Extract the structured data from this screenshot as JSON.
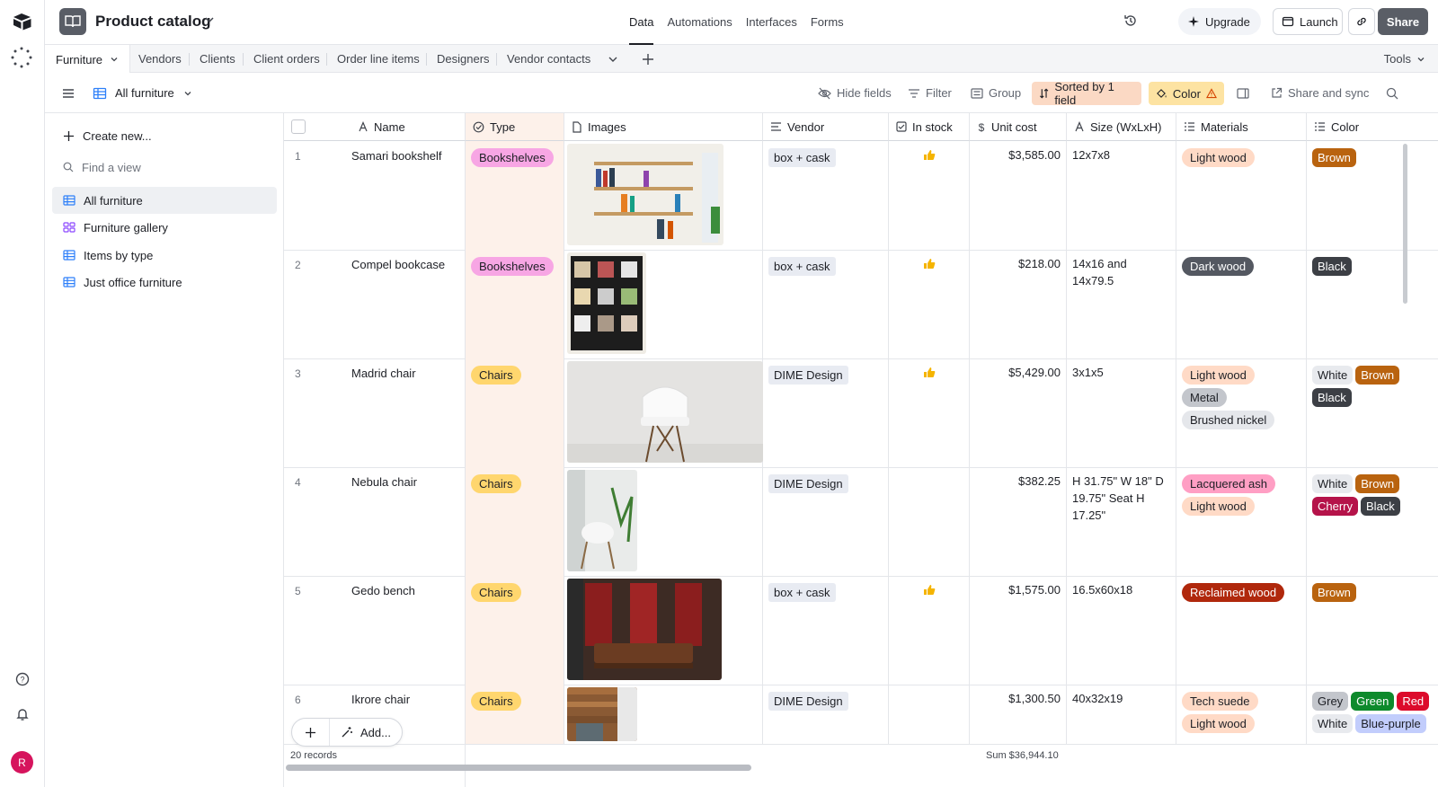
{
  "header": {
    "base_title": "Product catalog",
    "nav": [
      "Data",
      "Automations",
      "Interfaces",
      "Forms"
    ],
    "upgrade": "Upgrade",
    "launch": "Launch",
    "share": "Share"
  },
  "tabs": {
    "active": "Furniture",
    "items": [
      "Vendors",
      "Clients",
      "Client orders",
      "Order line items",
      "Designers",
      "Vendor contacts"
    ],
    "tools": "Tools"
  },
  "viewbar": {
    "view_name": "All furniture",
    "hide_fields": "Hide fields",
    "filter": "Filter",
    "group": "Group",
    "sorted": "Sorted by 1 field",
    "color": "Color",
    "share_sync": "Share and sync"
  },
  "sidebar": {
    "create_new": "Create new...",
    "find_view": "Find a view",
    "views": [
      "All furniture",
      "Furniture gallery",
      "Items by type",
      "Just office furniture"
    ]
  },
  "columns": [
    "Name",
    "Type",
    "Images",
    "Vendor",
    "In stock",
    "Unit cost",
    "Size (WxLxH)",
    "Materials",
    "Color"
  ],
  "rows": [
    {
      "num": "1",
      "name": "Samari bookshelf",
      "type": "Bookshelves",
      "vendor": "box + cask",
      "in_stock": true,
      "cost": "$3,585.00",
      "size": "12x7x8",
      "materials": [
        "Light wood"
      ],
      "colors": [
        "Brown"
      ]
    },
    {
      "num": "2",
      "name": "Compel bookcase",
      "type": "Bookshelves",
      "vendor": "box + cask",
      "in_stock": true,
      "cost": "$218.00",
      "size": "14x16 and 14x79.5",
      "materials": [
        "Dark wood"
      ],
      "colors": [
        "Black"
      ]
    },
    {
      "num": "3",
      "name": "Madrid chair",
      "type": "Chairs",
      "vendor": "DIME Design",
      "in_stock": true,
      "cost": "$5,429.00",
      "size": "3x1x5",
      "materials": [
        "Light wood",
        "Metal",
        "Brushed nickel"
      ],
      "colors": [
        "White",
        "Brown",
        "Black"
      ]
    },
    {
      "num": "4",
      "name": "Nebula chair",
      "type": "Chairs",
      "vendor": "DIME Design",
      "in_stock": false,
      "cost": "$382.25",
      "size": "H 31.75\" W 18\" D 19.75\" Seat H 17.25\"",
      "materials": [
        "Lacquered ash",
        "Light wood"
      ],
      "colors": [
        "White",
        "Brown",
        "Cherry",
        "Black"
      ]
    },
    {
      "num": "5",
      "name": "Gedo bench",
      "type": "Chairs",
      "vendor": "box + cask",
      "in_stock": true,
      "cost": "$1,575.00",
      "size": "16.5x60x18",
      "materials": [
        "Reclaimed wood"
      ],
      "colors": [
        "Brown"
      ]
    },
    {
      "num": "6",
      "name": "Ikrore chair",
      "type": "Chairs",
      "vendor": "DIME Design",
      "in_stock": false,
      "cost": "$1,300.50",
      "size": "40x32x19",
      "materials": [
        "Tech suede",
        "Light wood"
      ],
      "colors": [
        "Grey",
        "Green",
        "Red",
        "White",
        "Blue-purple"
      ]
    }
  ],
  "footer": {
    "records": "20 records",
    "sum": "Sum $36,944.10",
    "add": "Add..."
  },
  "pill_colors": {
    "Bookshelves": {
      "bg": "#f7a6e4",
      "fg": "#1d1f25"
    },
    "Chairs": {
      "bg": "#ffd66e",
      "fg": "#1d1f25"
    },
    "Light wood": {
      "bg": "#ffdac6",
      "fg": "#1d1f25"
    },
    "Dark wood": {
      "bg": "#545861",
      "fg": "#ffffff"
    },
    "Metal": {
      "bg": "#c3c6cc",
      "fg": "#1d1f25"
    },
    "Brushed nickel": {
      "bg": "#e5e7eb",
      "fg": "#1d1f25"
    },
    "Lacquered ash": {
      "bg": "#ff9fc4",
      "fg": "#1d1f25"
    },
    "Reclaimed wood": {
      "bg": "#b0280c",
      "fg": "#ffffff"
    },
    "Tech suede": {
      "bg": "#ffdac6",
      "fg": "#1d1f25"
    },
    "Brown": {
      "bg": "#b9630f",
      "fg": "#ffffff"
    },
    "Black": {
      "bg": "#3c3f45",
      "fg": "#ffffff"
    },
    "White": {
      "bg": "#e8eaee",
      "fg": "#1d1f25"
    },
    "Cherry": {
      "bg": "#b5134a",
      "fg": "#ffffff"
    },
    "Grey": {
      "bg": "#c3c6cc",
      "fg": "#1d1f25"
    },
    "Green": {
      "bg": "#0e8a2c",
      "fg": "#ffffff"
    },
    "Red": {
      "bg": "#dc0b2b",
      "fg": "#ffffff"
    },
    "Blue-purple": {
      "bg": "#c2cdfc",
      "fg": "#1d1f25"
    }
  }
}
